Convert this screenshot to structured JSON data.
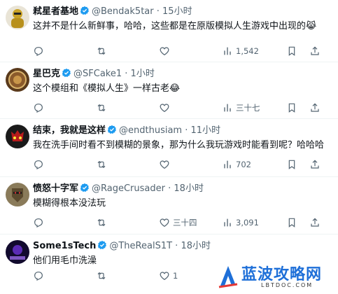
{
  "tweets": [
    {
      "name": "弒星者基地",
      "handle": "@Bendak5tar",
      "time": "15小时",
      "text": "这并不是什么新鲜事，哈哈，这些都是在原版模拟人生游戏中出现的",
      "emoji": "😹",
      "views": "1,542"
    },
    {
      "name": "星巴克",
      "handle": "@SFCake1",
      "time": "1小时",
      "text": "这个模组和《模拟人生》一样古老",
      "emoji": "😂",
      "views": "三十七"
    },
    {
      "name": "结束，我就是这样",
      "handle": "@endthusiam",
      "time": "11小时",
      "text": "我在洗手间时看不到模糊的景象，那为什么我玩游戏时能看到呢？哈哈哈",
      "emoji": "",
      "views": "702"
    },
    {
      "name": "愤怒十字军",
      "handle": "@RageCrusader",
      "time": "18小时",
      "text": "模糊得根本没法玩",
      "emoji": "",
      "views": "3,091",
      "likes": "三十四"
    },
    {
      "name": "Some1sTech",
      "handle": "@TheRealS1T",
      "time": "18小时",
      "text": "他们用毛巾洗澡",
      "emoji": "",
      "likes": "1"
    }
  ],
  "separator": "·",
  "watermark": {
    "title": "蓝波攻略网",
    "url": "LBTDOC.COM"
  },
  "colors": {
    "text": "#0f1419",
    "secondary": "#536471",
    "verified": "#1d9bf0",
    "divider": "#eff3f4",
    "watermark": "#1e6fd8"
  },
  "icons": [
    "reply-icon",
    "retweet-icon",
    "like-icon",
    "views-icon",
    "bookmark-icon",
    "share-icon",
    "verified-badge-icon"
  ]
}
